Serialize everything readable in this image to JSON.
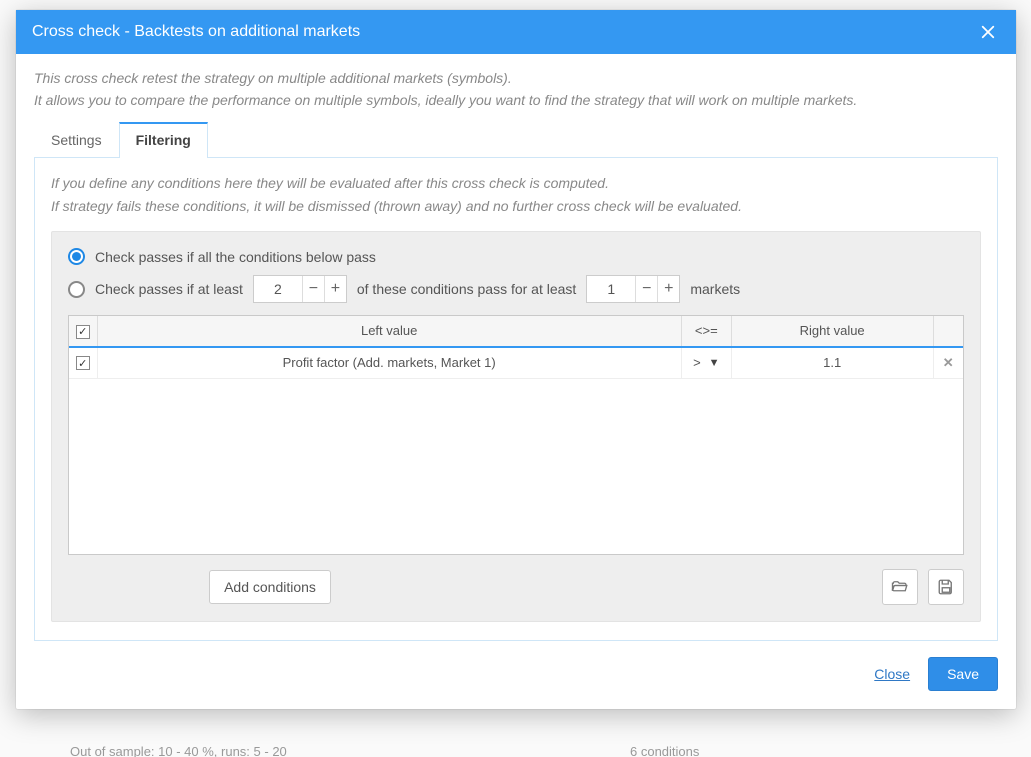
{
  "modal": {
    "title": "Cross check - Backtests on additional markets",
    "description_line1": "This cross check retest the strategy on multiple additional markets (symbols).",
    "description_line2": "It allows you to compare the performance on multiple symbols, ideally you want to find the strategy that will work on multiple markets."
  },
  "tabs": {
    "settings_label": "Settings",
    "filtering_label": "Filtering"
  },
  "filtering": {
    "info_line1": "If you define any conditions here they will be evaluated after this cross check is computed.",
    "info_line2": "If strategy fails these conditions, it will be dismissed (thrown away) and no further cross check will be evaluated.",
    "radio_all_label": "Check passes if all the conditions below pass",
    "radio_atleast_prefix": "Check passes if at least",
    "radio_atleast_mid": "of these conditions pass for at least",
    "radio_atleast_suffix": "markets",
    "atleast_conditions_value": "2",
    "atleast_markets_value": "1",
    "table": {
      "col_left": "Left value",
      "col_op": "<>=",
      "col_right": "Right value",
      "rows": [
        {
          "checked": true,
          "left": "Profit factor (Add. markets, Market 1)",
          "op": ">",
          "right": "1.1"
        }
      ]
    },
    "add_conditions_label": "Add conditions"
  },
  "footer": {
    "close_label": "Close",
    "save_label": "Save"
  },
  "background": {
    "hint1": "Out of sample: 10 - 40 %, runs: 5 - 20",
    "hint2": "6 conditions"
  }
}
